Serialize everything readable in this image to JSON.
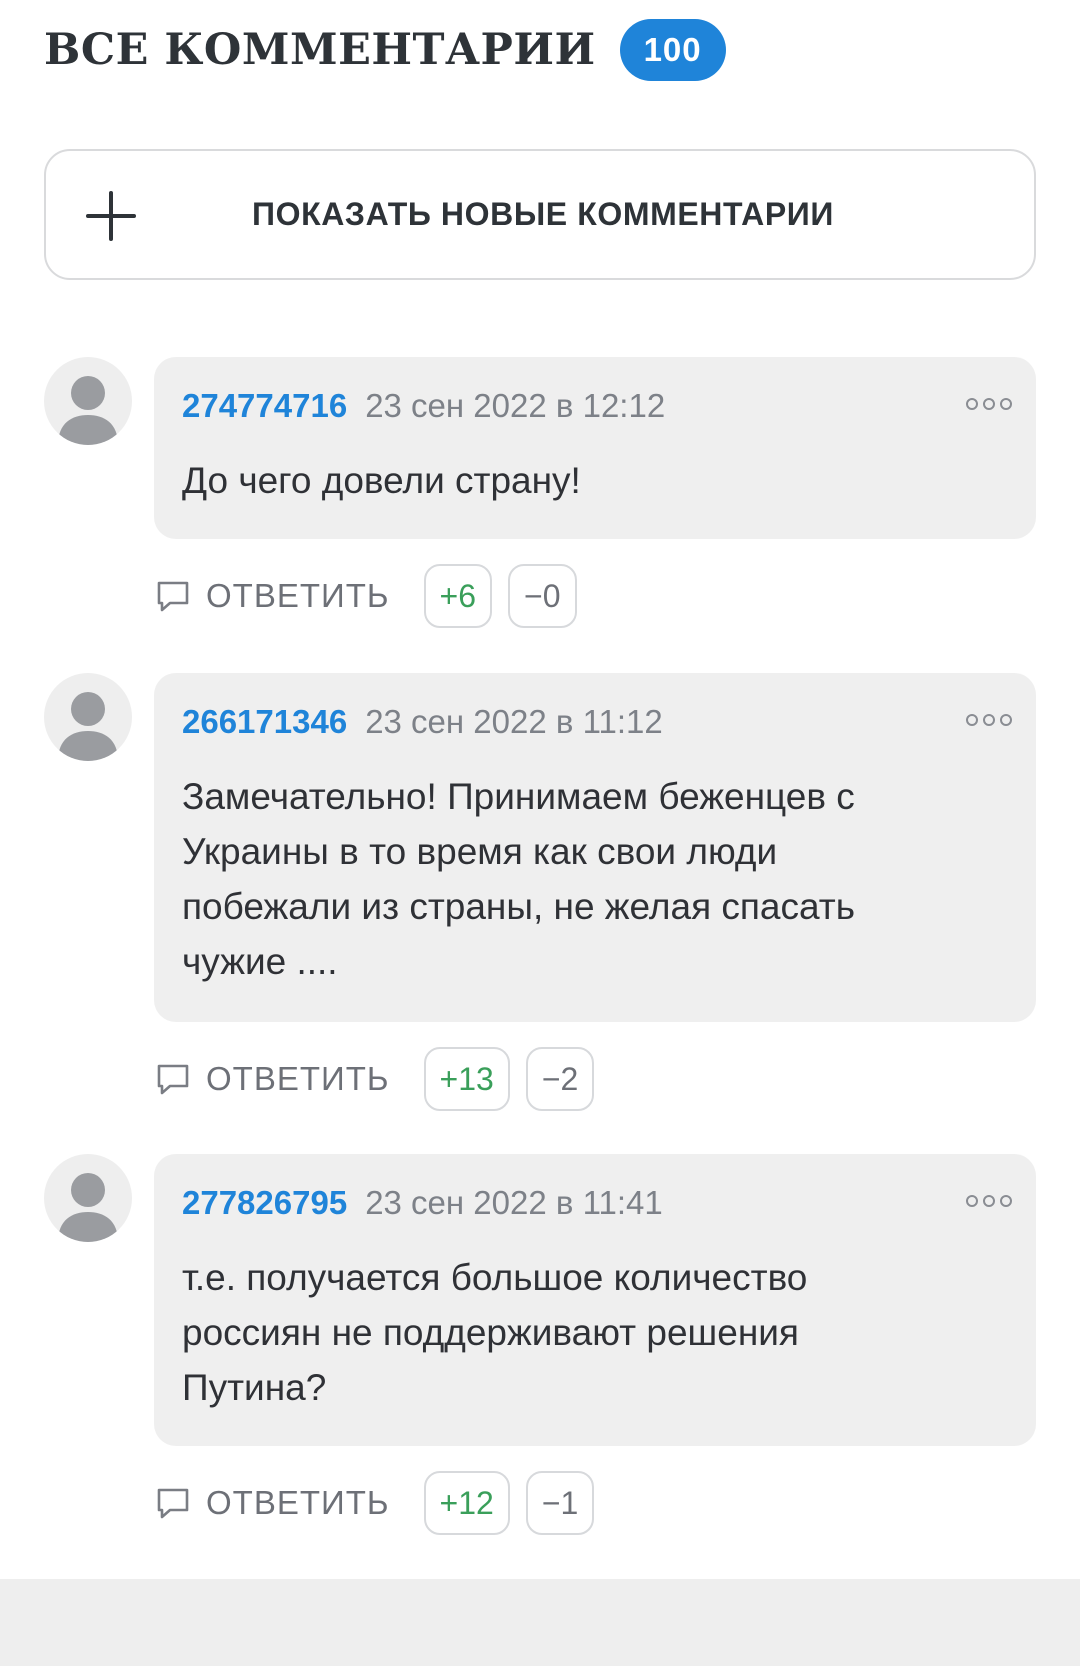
{
  "header": {
    "title": "ВСЕ КОММЕНТАРИИ",
    "count": "100"
  },
  "show_new": {
    "label": "ПОКАЗАТЬ НОВЫЕ КОММЕНТАРИИ",
    "icon": "plus-icon"
  },
  "comments": [
    {
      "author": "274774716",
      "date": "23 сен 2022 в 12:12",
      "text": "До чего довели страну!",
      "reply_label": "ОТВЕТИТЬ",
      "up": "+6",
      "down": "−0"
    },
    {
      "author": "266171346",
      "date": "23 сен 2022 в 11:12",
      "text": "Замечательно! Принимаем беженцев с\nУкраины в то время как свои люди\nпобежали из страны, не желая спасать\nчужие ....",
      "reply_label": "ОТВЕТИТЬ",
      "up": "+13",
      "down": "−2"
    },
    {
      "author": "277826795",
      "date": "23 сен 2022 в 11:41",
      "text": "т.е. получается большое количество\nроссиян не поддерживают решения\nПутина?",
      "reply_label": "ОТВЕТИТЬ",
      "up": "+12",
      "down": "−1"
    }
  ],
  "colors": {
    "accent": "#1f84d9",
    "positive": "#3a9f5a",
    "bubble": "#efefef"
  }
}
